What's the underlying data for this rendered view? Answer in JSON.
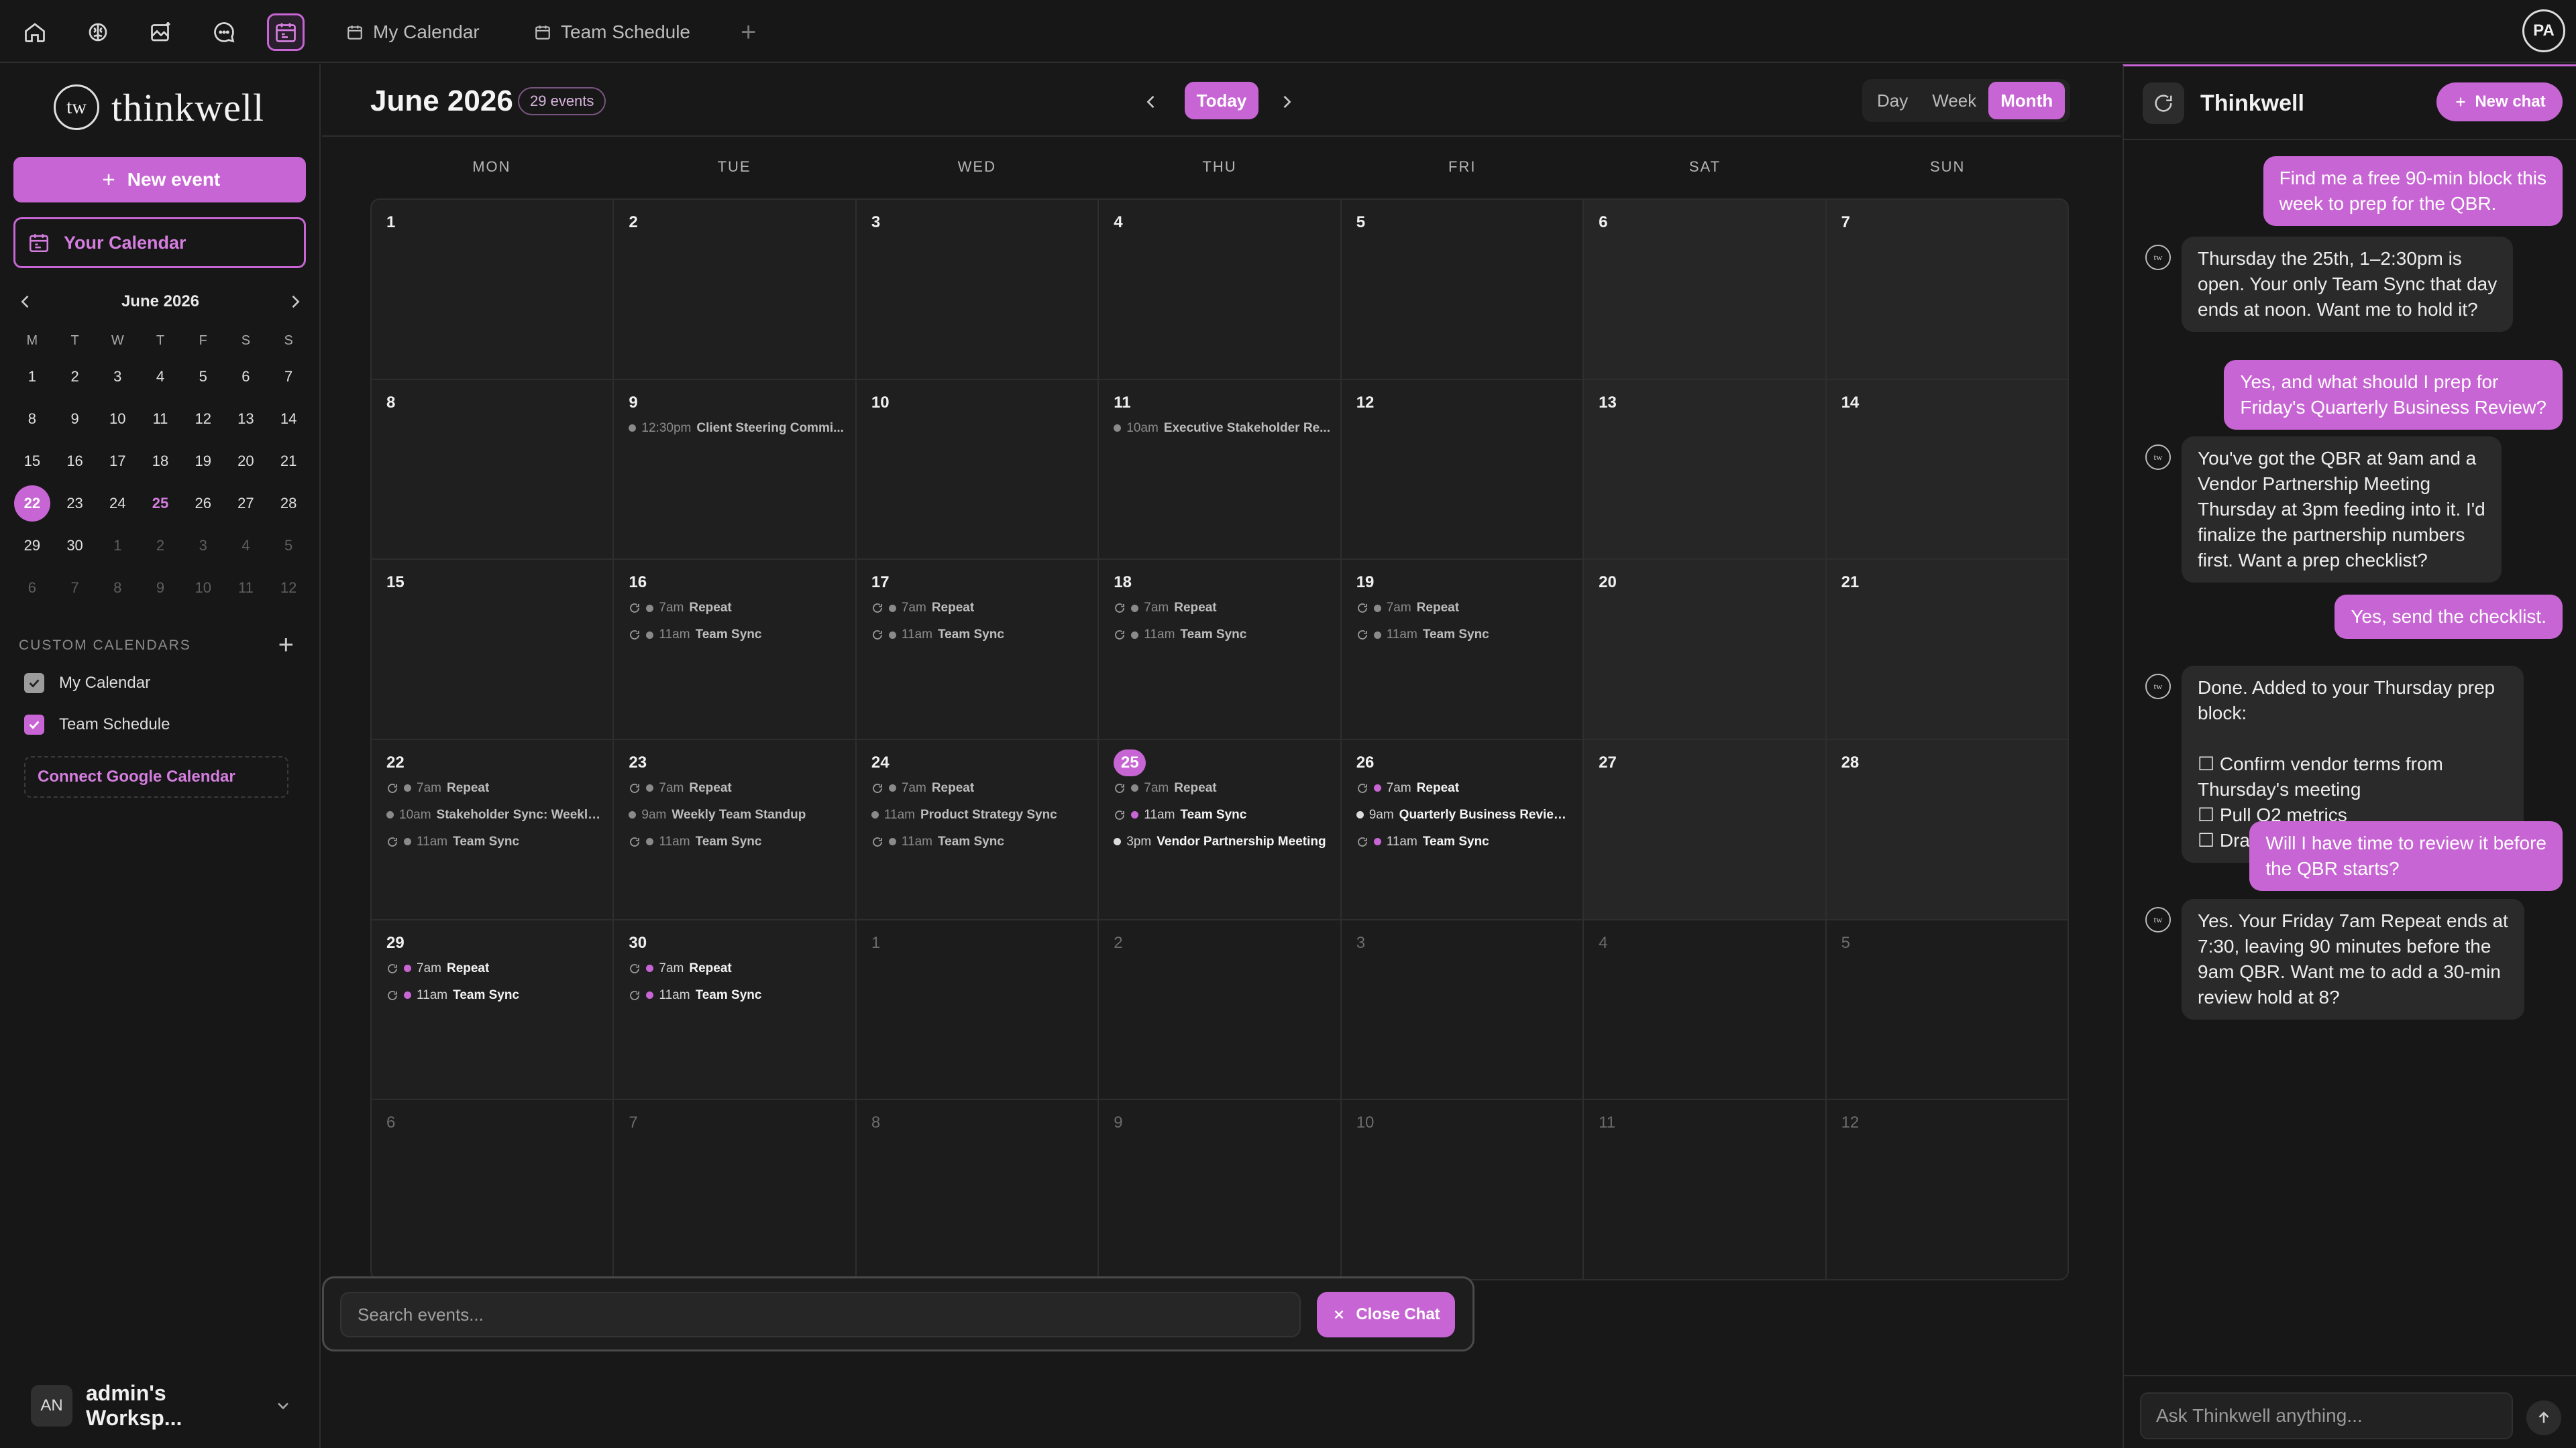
{
  "topbar": {
    "tabs": [
      {
        "label": "My Calendar"
      },
      {
        "label": "Team Schedule"
      }
    ],
    "add_tab": "+",
    "user_initials": "PA"
  },
  "sidebar": {
    "logo_mark": "tw",
    "logo_text": "thinkwell",
    "new_event": "New event",
    "your_calendar": "Your Calendar",
    "mini_calendar": {
      "title": "June 2026",
      "dows": [
        "M",
        "T",
        "W",
        "T",
        "F",
        "S",
        "S"
      ],
      "weeks": [
        [
          {
            "d": "1"
          },
          {
            "d": "2"
          },
          {
            "d": "3"
          },
          {
            "d": "4"
          },
          {
            "d": "5"
          },
          {
            "d": "6"
          },
          {
            "d": "7"
          }
        ],
        [
          {
            "d": "8"
          },
          {
            "d": "9"
          },
          {
            "d": "10"
          },
          {
            "d": "11"
          },
          {
            "d": "12"
          },
          {
            "d": "13"
          },
          {
            "d": "14"
          }
        ],
        [
          {
            "d": "15"
          },
          {
            "d": "16"
          },
          {
            "d": "17"
          },
          {
            "d": "18"
          },
          {
            "d": "19"
          },
          {
            "d": "20"
          },
          {
            "d": "21"
          }
        ],
        [
          {
            "d": "22",
            "sel": true
          },
          {
            "d": "23"
          },
          {
            "d": "24"
          },
          {
            "d": "25",
            "hl": true
          },
          {
            "d": "26"
          },
          {
            "d": "27"
          },
          {
            "d": "28"
          }
        ],
        [
          {
            "d": "29"
          },
          {
            "d": "30"
          },
          {
            "d": "1",
            "other": true
          },
          {
            "d": "2",
            "other": true
          },
          {
            "d": "3",
            "other": true
          },
          {
            "d": "4",
            "other": true
          },
          {
            "d": "5",
            "other": true
          }
        ],
        [
          {
            "d": "6",
            "other": true
          },
          {
            "d": "7",
            "other": true
          },
          {
            "d": "8",
            "other": true
          },
          {
            "d": "9",
            "other": true
          },
          {
            "d": "10",
            "other": true
          },
          {
            "d": "11",
            "other": true
          },
          {
            "d": "12",
            "other": true
          }
        ]
      ]
    },
    "custom_calendars_label": "CUSTOM CALENDARS",
    "calendars": [
      {
        "label": "My Calendar",
        "color": "grey"
      },
      {
        "label": "Team Schedule",
        "color": "pink"
      }
    ],
    "connect_google": "Connect Google Calendar",
    "workspace_initials": "AN",
    "workspace_name": "admin's Worksp..."
  },
  "main": {
    "month_title": "June 2026",
    "event_count": "29 events",
    "today": "Today",
    "views": [
      {
        "label": "Day"
      },
      {
        "label": "Week"
      },
      {
        "label": "Month",
        "active": true
      }
    ],
    "dows": [
      "MON",
      "TUE",
      "WED",
      "THU",
      "FRI",
      "SAT",
      "SUN"
    ],
    "weeks": [
      [
        {
          "d": "1"
        },
        {
          "d": "2"
        },
        {
          "d": "3"
        },
        {
          "d": "4"
        },
        {
          "d": "5"
        },
        {
          "d": "6",
          "wk": true
        },
        {
          "d": "7",
          "wk": true
        }
      ],
      [
        {
          "d": "8"
        },
        {
          "d": "9",
          "events": [
            {
              "time": "12:30pm",
              "title": "Client Steering Commi...",
              "dot": "g"
            }
          ]
        },
        {
          "d": "10"
        },
        {
          "d": "11",
          "events": [
            {
              "time": "10am",
              "title": "Executive Stakeholder Re...",
              "dot": "g"
            }
          ]
        },
        {
          "d": "12"
        },
        {
          "d": "13",
          "wk": true
        },
        {
          "d": "14",
          "wk": true
        }
      ],
      [
        {
          "d": "15"
        },
        {
          "d": "16",
          "events": [
            {
              "time": "7am",
              "title": "Repeat",
              "dot": "g",
              "rep": true
            },
            {
              "time": "11am",
              "title": "Team Sync",
              "dot": "g",
              "rep": true
            }
          ]
        },
        {
          "d": "17",
          "events": [
            {
              "time": "7am",
              "title": "Repeat",
              "dot": "g",
              "rep": true
            },
            {
              "time": "11am",
              "title": "Team Sync",
              "dot": "g",
              "rep": true
            }
          ]
        },
        {
          "d": "18",
          "events": [
            {
              "time": "7am",
              "title": "Repeat",
              "dot": "g",
              "rep": true
            },
            {
              "time": "11am",
              "title": "Team Sync",
              "dot": "g",
              "rep": true
            }
          ]
        },
        {
          "d": "19",
          "events": [
            {
              "time": "7am",
              "title": "Repeat",
              "dot": "g",
              "rep": true
            },
            {
              "time": "11am",
              "title": "Team Sync",
              "dot": "g",
              "rep": true
            }
          ]
        },
        {
          "d": "20",
          "wk": true
        },
        {
          "d": "21",
          "wk": true
        }
      ],
      [
        {
          "d": "22",
          "events": [
            {
              "time": "7am",
              "title": "Repeat",
              "dot": "g",
              "rep": true
            },
            {
              "time": "10am",
              "title": "Stakeholder Sync: Weekly...",
              "dot": "g"
            },
            {
              "time": "11am",
              "title": "Team Sync",
              "dot": "g",
              "rep": true
            }
          ]
        },
        {
          "d": "23",
          "events": [
            {
              "time": "7am",
              "title": "Repeat",
              "dot": "g",
              "rep": true
            },
            {
              "time": "9am",
              "title": "Weekly Team Standup",
              "dot": "g"
            },
            {
              "time": "11am",
              "title": "Team Sync",
              "dot": "g",
              "rep": true
            }
          ]
        },
        {
          "d": "24",
          "events": [
            {
              "time": "7am",
              "title": "Repeat",
              "dot": "g",
              "rep": true
            },
            {
              "time": "11am",
              "title": "Product Strategy Sync",
              "dot": "g"
            },
            {
              "time": "11am",
              "title": "Team Sync",
              "dot": "g",
              "rep": true
            }
          ]
        },
        {
          "d": "25",
          "today": true,
          "events": [
            {
              "time": "7am",
              "title": "Repeat",
              "dot": "g",
              "rep": true
            },
            {
              "time": "11am",
              "title": "Team Sync",
              "dot": "p",
              "rep": true,
              "hi": true
            },
            {
              "time": "3pm",
              "title": "Vendor Partnership Meeting",
              "dot": "w",
              "hi": true
            }
          ]
        },
        {
          "d": "26",
          "events": [
            {
              "time": "7am",
              "title": "Repeat",
              "dot": "p",
              "rep": true,
              "hi": true
            },
            {
              "time": "9am",
              "title": "Quarterly Business Review...",
              "dot": "w",
              "hi": true
            },
            {
              "time": "11am",
              "title": "Team Sync",
              "dot": "p",
              "rep": true,
              "hi": true
            }
          ]
        },
        {
          "d": "27",
          "wk": true
        },
        {
          "d": "28",
          "wk": true
        }
      ],
      [
        {
          "d": "29",
          "events": [
            {
              "time": "7am",
              "title": "Repeat",
              "dot": "p",
              "rep": true,
              "hi": true
            },
            {
              "time": "11am",
              "title": "Team Sync",
              "dot": "p",
              "rep": true,
              "hi": true
            }
          ]
        },
        {
          "d": "30",
          "events": [
            {
              "time": "7am",
              "title": "Repeat",
              "dot": "p",
              "rep": true,
              "hi": true
            },
            {
              "time": "11am",
              "title": "Team Sync",
              "dot": "p",
              "rep": true,
              "hi": true
            }
          ]
        },
        {
          "d": "1",
          "out": true
        },
        {
          "d": "2",
          "out": true
        },
        {
          "d": "3",
          "out": true
        },
        {
          "d": "4",
          "out": true
        },
        {
          "d": "5",
          "out": true
        }
      ],
      [
        {
          "d": "6",
          "out": true
        },
        {
          "d": "7",
          "out": true
        },
        {
          "d": "8",
          "out": true
        },
        {
          "d": "9",
          "out": true
        },
        {
          "d": "10",
          "out": true
        },
        {
          "d": "11",
          "out": true
        },
        {
          "d": "12",
          "out": true
        }
      ]
    ],
    "search_placeholder": "Search events...",
    "close_chat": "Close Chat"
  },
  "chat": {
    "title": "Thinkwell",
    "new_chat": "New chat",
    "bot_mark": "tw",
    "messages": [
      {
        "role": "user",
        "lines": [
          "Find me a free 90-min block this",
          "week to prep for the QBR."
        ]
      },
      {
        "role": "assistant",
        "lines": [
          "Thursday the 25th, 1–2:30pm is",
          "open. Your only Team Sync that day",
          "ends at noon. Want me to hold it?"
        ]
      },
      {
        "role": "user",
        "lines": [
          "Yes, and what should I prep for",
          "Friday's Quarterly Business Review?"
        ]
      },
      {
        "role": "assistant",
        "lines": [
          "You've got the QBR at 9am and a",
          "Vendor Partnership Meeting",
          "Thursday at 3pm feeding into it. I'd",
          "finalize the partnership numbers",
          "first. Want a prep checklist?"
        ]
      },
      {
        "role": "user",
        "lines": [
          "Yes, send the checklist."
        ]
      },
      {
        "role": "assistant",
        "lines": [
          "Done. Added to your Thursday prep",
          "block:",
          "",
          "☐ Confirm vendor terms from",
          "Thursday's meeting",
          "☐ Pull Q2 metrics",
          "☐ Draft the renewal recommendation"
        ]
      },
      {
        "role": "user",
        "lines": [
          "Will I have time to review it before",
          "the QBR starts?"
        ]
      },
      {
        "role": "assistant",
        "lines": [
          "Yes. Your Friday 7am Repeat ends at",
          "7:30, leaving 90 minutes before the",
          "9am QBR. Want me to add a 30-min",
          "review hold at 8?"
        ]
      }
    ],
    "input_placeholder": "Ask Thinkwell anything..."
  }
}
